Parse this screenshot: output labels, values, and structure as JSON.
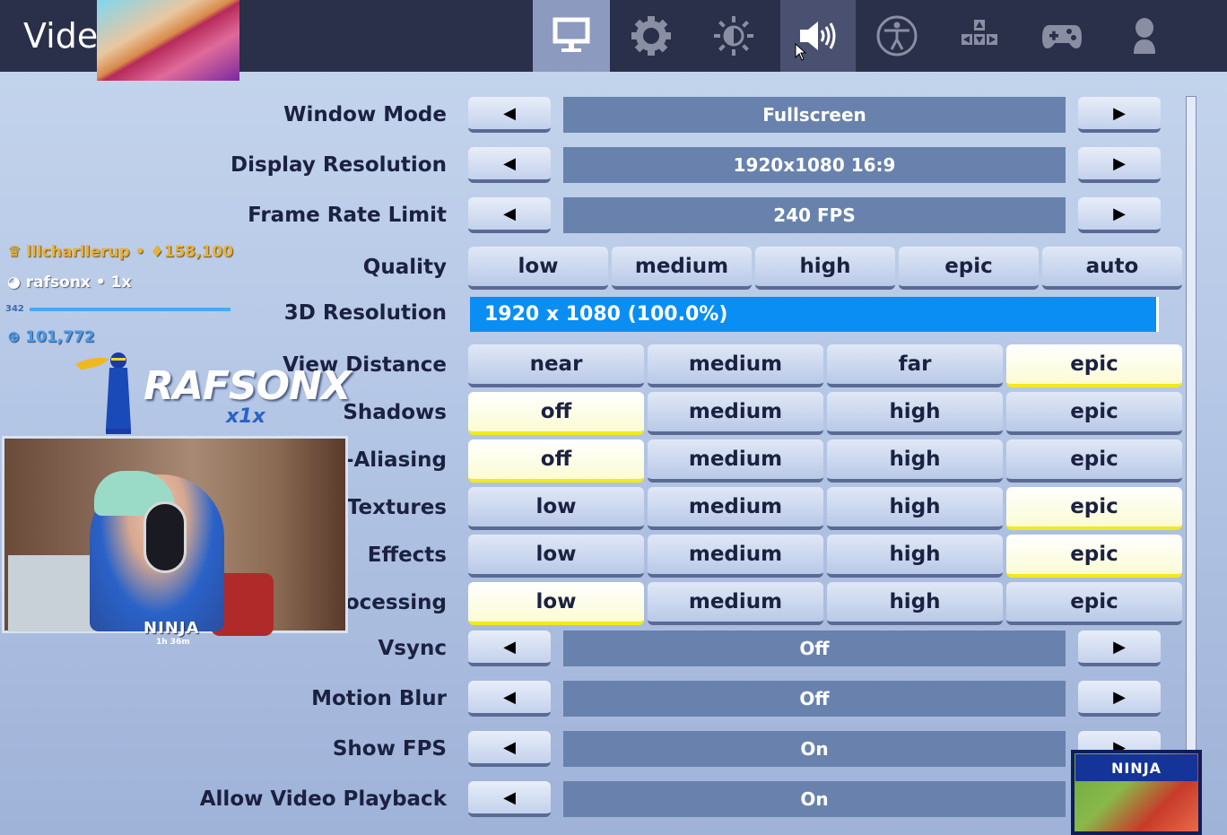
{
  "header": {
    "title": "Vide",
    "tabs": [
      {
        "name": "video",
        "icon": "monitor-icon",
        "active": true
      },
      {
        "name": "game",
        "icon": "gear-icon"
      },
      {
        "name": "brightness",
        "icon": "brightness-icon"
      },
      {
        "name": "audio",
        "icon": "speaker-icon",
        "hovered": true
      },
      {
        "name": "accessibility",
        "icon": "accessibility-icon"
      },
      {
        "name": "input",
        "icon": "arrow-keys-icon"
      },
      {
        "name": "controller",
        "icon": "gamepad-icon"
      },
      {
        "name": "account",
        "icon": "user-icon"
      }
    ]
  },
  "settings": {
    "window_mode": {
      "label": "Window Mode",
      "value": "Fullscreen"
    },
    "display_resolution": {
      "label": "Display Resolution",
      "value": "1920x1080 16:9"
    },
    "frame_rate_limit": {
      "label": "Frame Rate Limit",
      "value": "240 FPS"
    },
    "quality": {
      "label": "Quality",
      "options": [
        "low",
        "medium",
        "high",
        "epic",
        "auto"
      ],
      "selected": null
    },
    "resolution_3d": {
      "label": "3D Resolution",
      "value": "1920 x 1080 (100.0%)",
      "percent": 100
    },
    "view_distance": {
      "label": "View Distance",
      "options": [
        "near",
        "medium",
        "far",
        "epic"
      ],
      "selected": "epic"
    },
    "shadows": {
      "label": "Shadows",
      "options": [
        "off",
        "medium",
        "high",
        "epic"
      ],
      "selected": "off"
    },
    "anti_aliasing": {
      "label": "i-Aliasing",
      "options": [
        "off",
        "medium",
        "high",
        "epic"
      ],
      "selected": "off"
    },
    "textures": {
      "label": "Textures",
      "options": [
        "low",
        "medium",
        "high",
        "epic"
      ],
      "selected": "epic"
    },
    "effects": {
      "label": "Effects",
      "options": [
        "low",
        "medium",
        "high",
        "epic"
      ],
      "selected": "epic"
    },
    "post_processing": {
      "label": "rocessing",
      "options": [
        "low",
        "medium",
        "high",
        "epic"
      ],
      "selected": "low"
    },
    "vsync": {
      "label": "Vsync",
      "value": "Off"
    },
    "motion_blur": {
      "label": "Motion Blur",
      "value": "Off"
    },
    "show_fps": {
      "label": "Show FPS",
      "value": "On"
    },
    "allow_video_playback": {
      "label": "Allow Video Playback",
      "value": "On"
    }
  },
  "arrows": {
    "left": "◀",
    "right": "▶"
  },
  "stream_overlay": {
    "top_donor": "lllcharllerup",
    "top_donor_amount": "♦158,100",
    "recent_sub": "rafsonx",
    "recent_sub_count": "1x",
    "xp_level": "342",
    "followers": "101,772",
    "logo_text": "RAFSONX",
    "logo_sub": "x1x",
    "cam_name": "NINJA",
    "cam_uptime": "1h 36m",
    "ad_brand": "NINJA",
    "separator": "•"
  }
}
